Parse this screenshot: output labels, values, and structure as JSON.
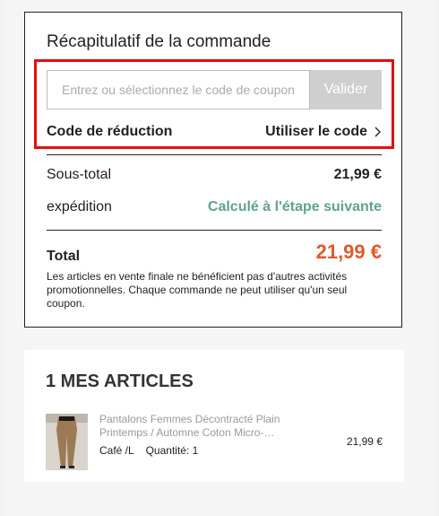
{
  "summary": {
    "title": "Récapitulatif de la commande",
    "coupon_placeholder": "Entrez ou sélectionnez le code de coupon",
    "apply_label": "Valider",
    "discount_label": "Code de réduction",
    "use_code_label": "Utiliser le code",
    "subtotal_label": "Sous-total",
    "subtotal_value": "21,99 €",
    "shipping_label": "expédition",
    "shipping_value": "Calculé à l'étape suivante",
    "total_label": "Total",
    "total_value": "21,99 €",
    "notice": "Les articles en vente finale ne bénéficient pas d'autres activités promotionnelles. Chaque commande ne peut utiliser qu'un seul coupon."
  },
  "items": {
    "title": "1 MES ARTICLES",
    "list": [
      {
        "name": "Pantalons Femmes Décontracté Plain Printemps / Automne Coton Micro-…",
        "variant": "Café /L",
        "quantity": "Quantité: 1",
        "price": "21,99 €"
      }
    ]
  },
  "colors": {
    "highlight": "#e01010",
    "shipping": "#5ea48a",
    "total": "#e05a2b",
    "apply_button": "#cfcfcf"
  }
}
